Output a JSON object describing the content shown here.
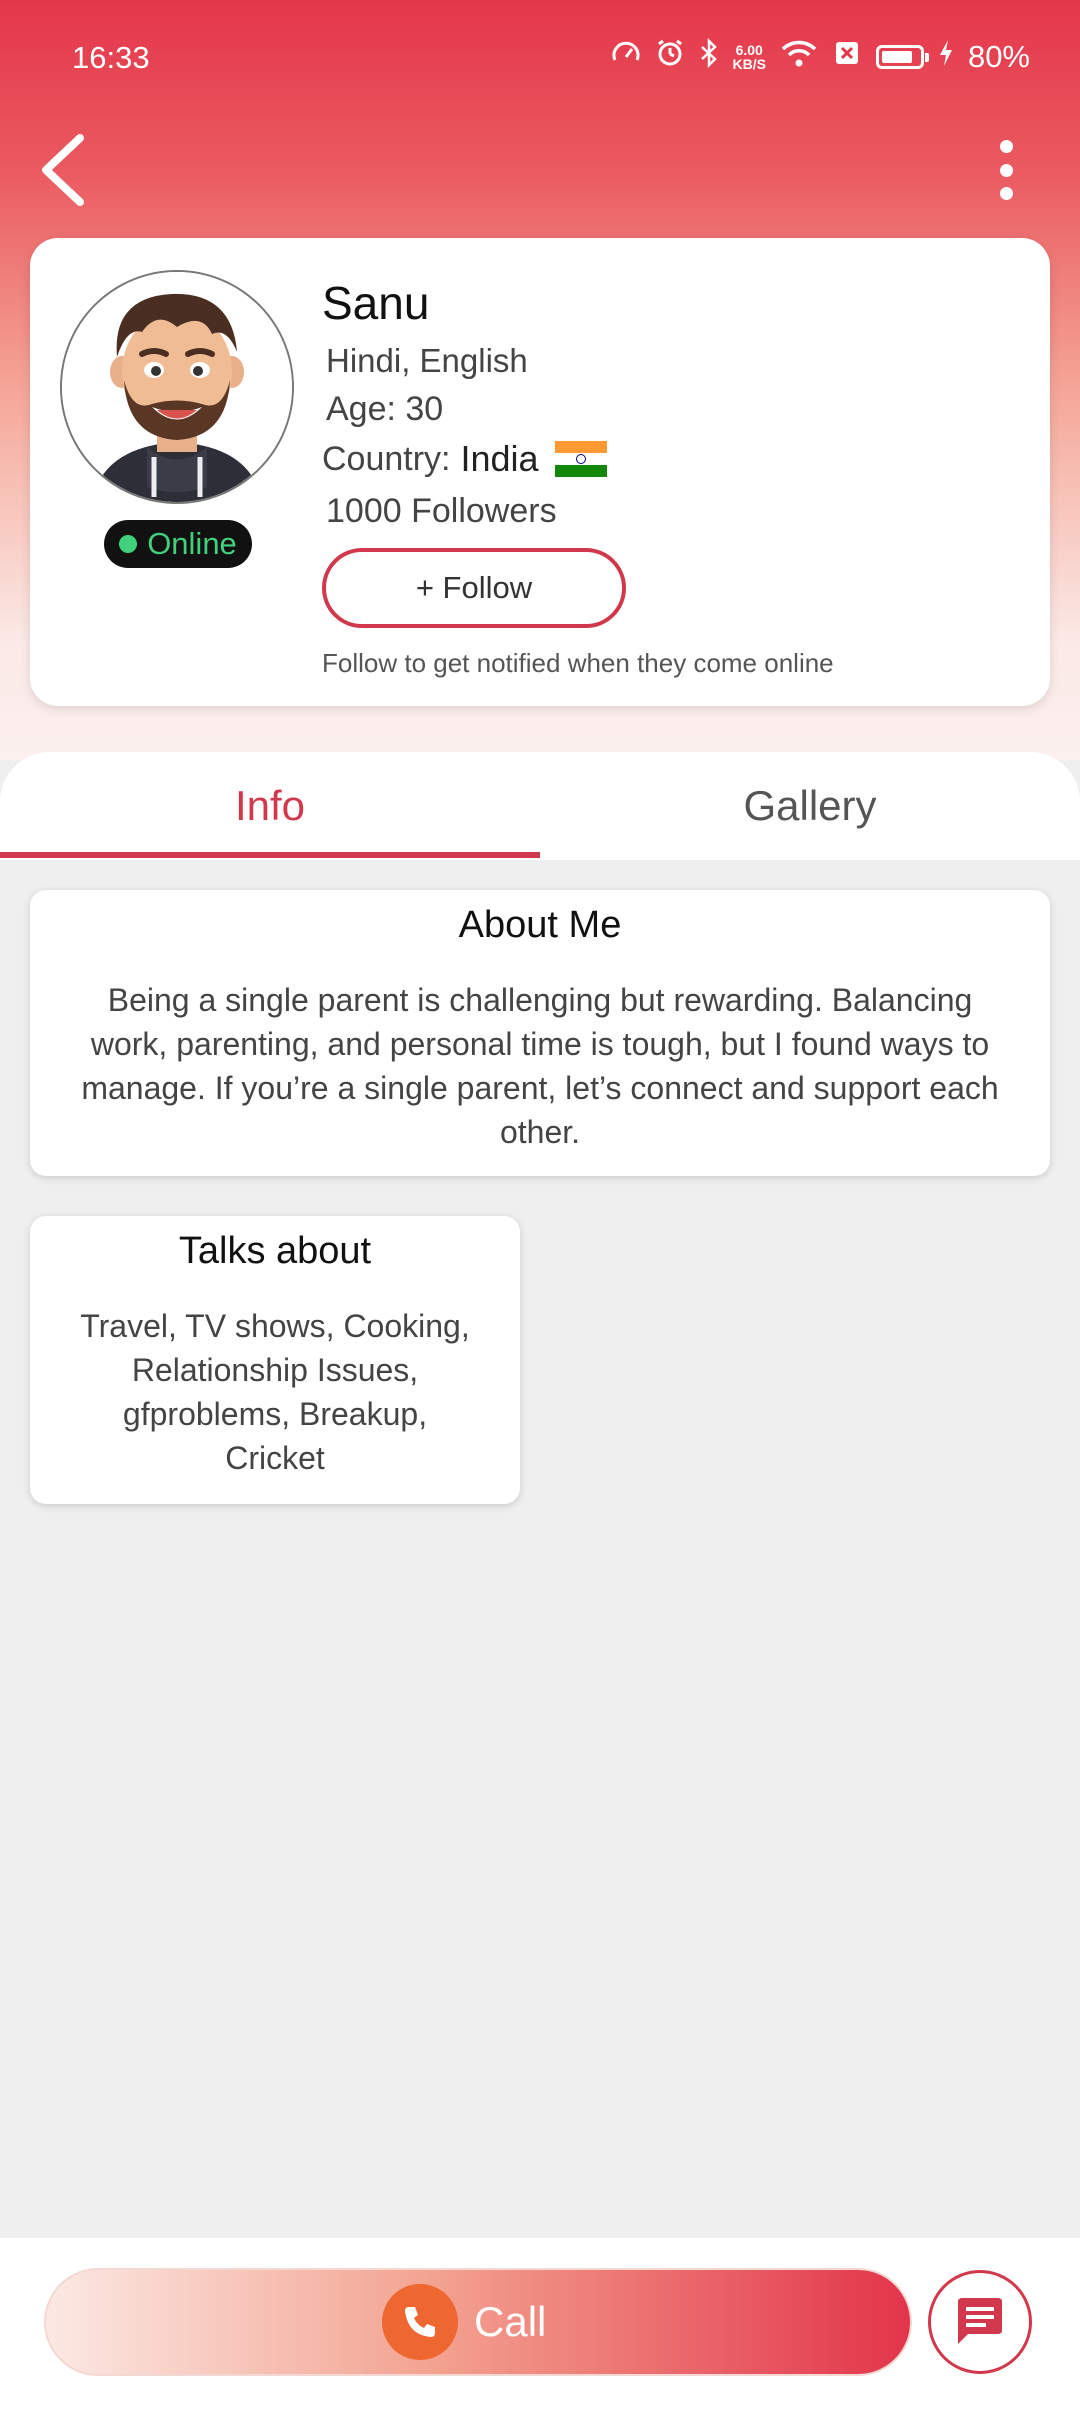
{
  "status_bar": {
    "time": "16:33",
    "net_speed_value": "6.00",
    "net_speed_unit": "KB/S",
    "battery": "80%"
  },
  "profile": {
    "name": "Sanu",
    "languages": "Hindi, English",
    "age": "Age: 30",
    "country_label": "Country:",
    "country_value": "India",
    "followers": "1000 Followers",
    "status": "Online",
    "follow_label": "+ Follow",
    "follow_hint": "Follow to get notified when they come online"
  },
  "tabs": [
    {
      "label": "Info",
      "active": true
    },
    {
      "label": "Gallery",
      "active": false
    }
  ],
  "about": {
    "title": "About Me",
    "text": "Being a single parent is challenging but rewarding. Balancing work, parenting, and personal time is tough, but I found ways to manage. If you’re a single parent, let’s connect and support each other."
  },
  "talks": {
    "title": "Talks about",
    "text": "Travel, TV shows, Cooking, Relationship Issues, gfproblems, Breakup, Cricket"
  },
  "actions": {
    "call_label": "Call"
  },
  "colors": {
    "accent": "#d2384b",
    "online": "#43d07d",
    "call_icon": "#ee6630"
  }
}
